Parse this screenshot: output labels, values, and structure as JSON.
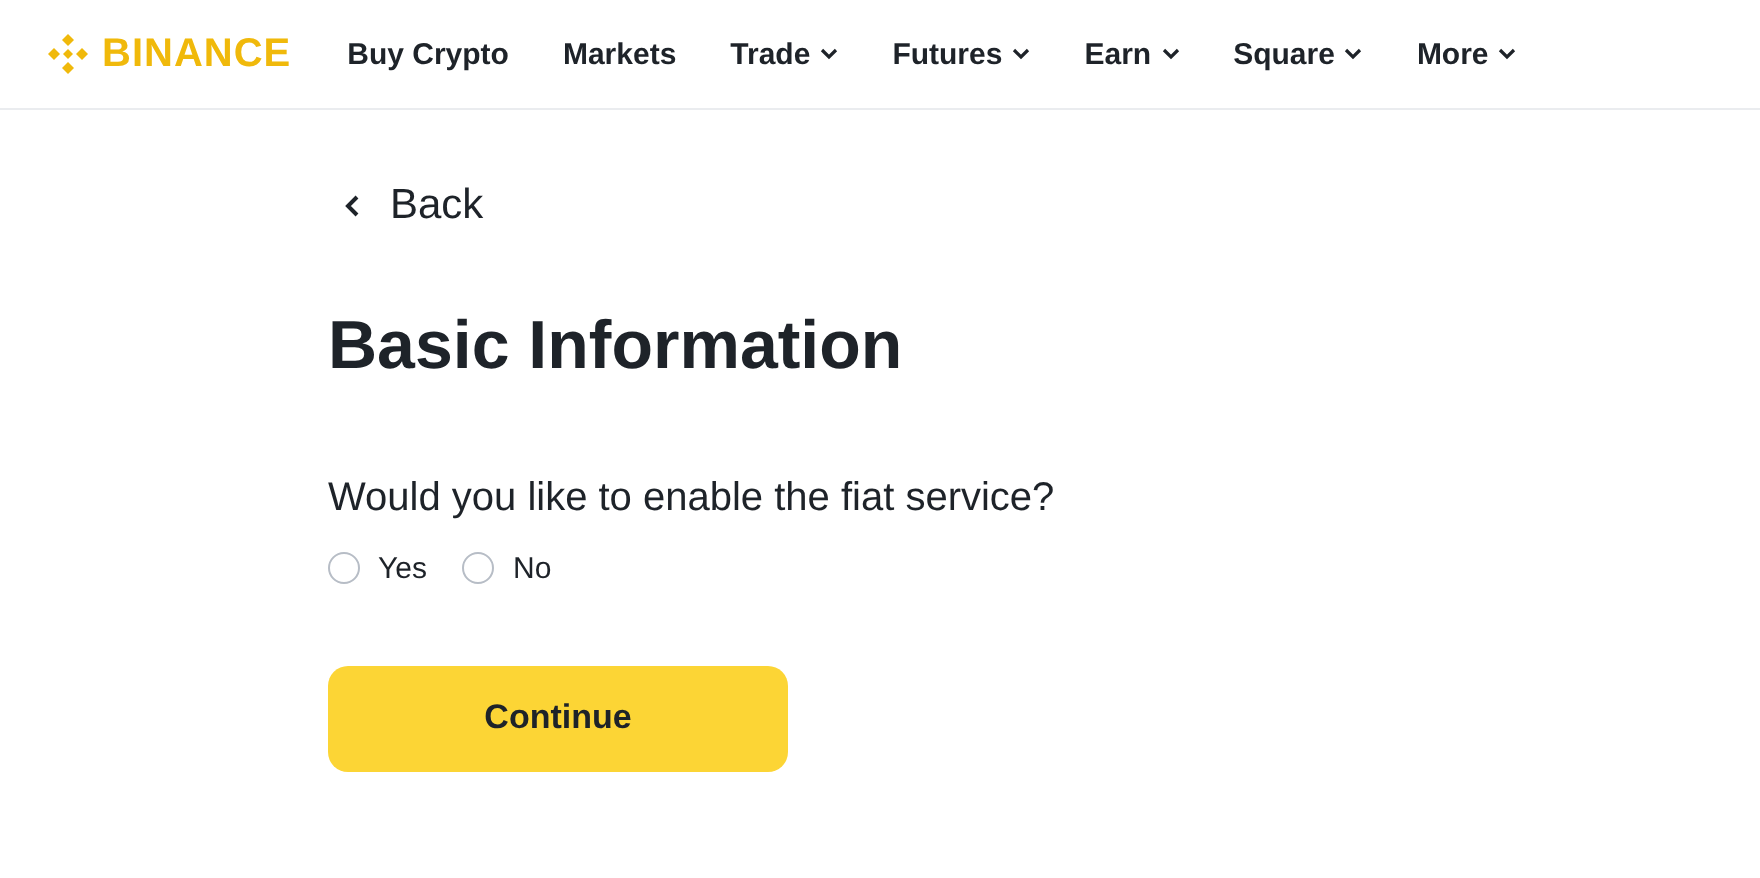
{
  "logo": {
    "text": "BINANCE"
  },
  "nav": [
    {
      "label": "Buy Crypto",
      "dropdown": false
    },
    {
      "label": "Markets",
      "dropdown": false
    },
    {
      "label": "Trade",
      "dropdown": true
    },
    {
      "label": "Futures",
      "dropdown": true
    },
    {
      "label": "Earn",
      "dropdown": true
    },
    {
      "label": "Square",
      "dropdown": true
    },
    {
      "label": "More",
      "dropdown": true
    }
  ],
  "back": {
    "label": "Back"
  },
  "title": "Basic Information",
  "question": "Would you like to enable the fiat service?",
  "options": [
    {
      "label": "Yes",
      "selected": false
    },
    {
      "label": "No",
      "selected": false
    }
  ],
  "button": {
    "label": "Continue"
  }
}
